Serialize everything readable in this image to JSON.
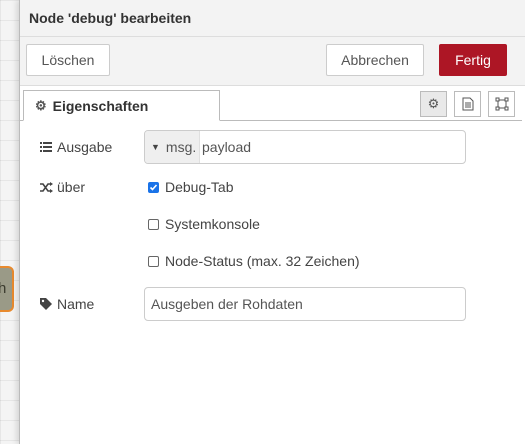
{
  "tray": {
    "title": "Node 'debug' bearbeiten"
  },
  "toolbar": {
    "delete_label": "Löschen",
    "cancel_label": "Abbrechen",
    "done_label": "Fertig"
  },
  "tabs": {
    "properties_label": "Eigenschaften",
    "icons": [
      "gear-icon",
      "description-icon",
      "appearance-icon"
    ]
  },
  "form": {
    "output_label": "Ausgabe",
    "output_type": "msg.",
    "output_value": "payload",
    "to_label": "über",
    "options": [
      {
        "label": "Debug-Tab",
        "checked": true
      },
      {
        "label": "Systemkonsole",
        "checked": false
      },
      {
        "label": "Node-Status (max. 32 Zeichen)",
        "checked": false
      }
    ],
    "name_label": "Name",
    "name_value": "Ausgeben der Rohdaten"
  },
  "colors": {
    "accent": "#ad1625",
    "checkbox": "#1a73e8"
  }
}
